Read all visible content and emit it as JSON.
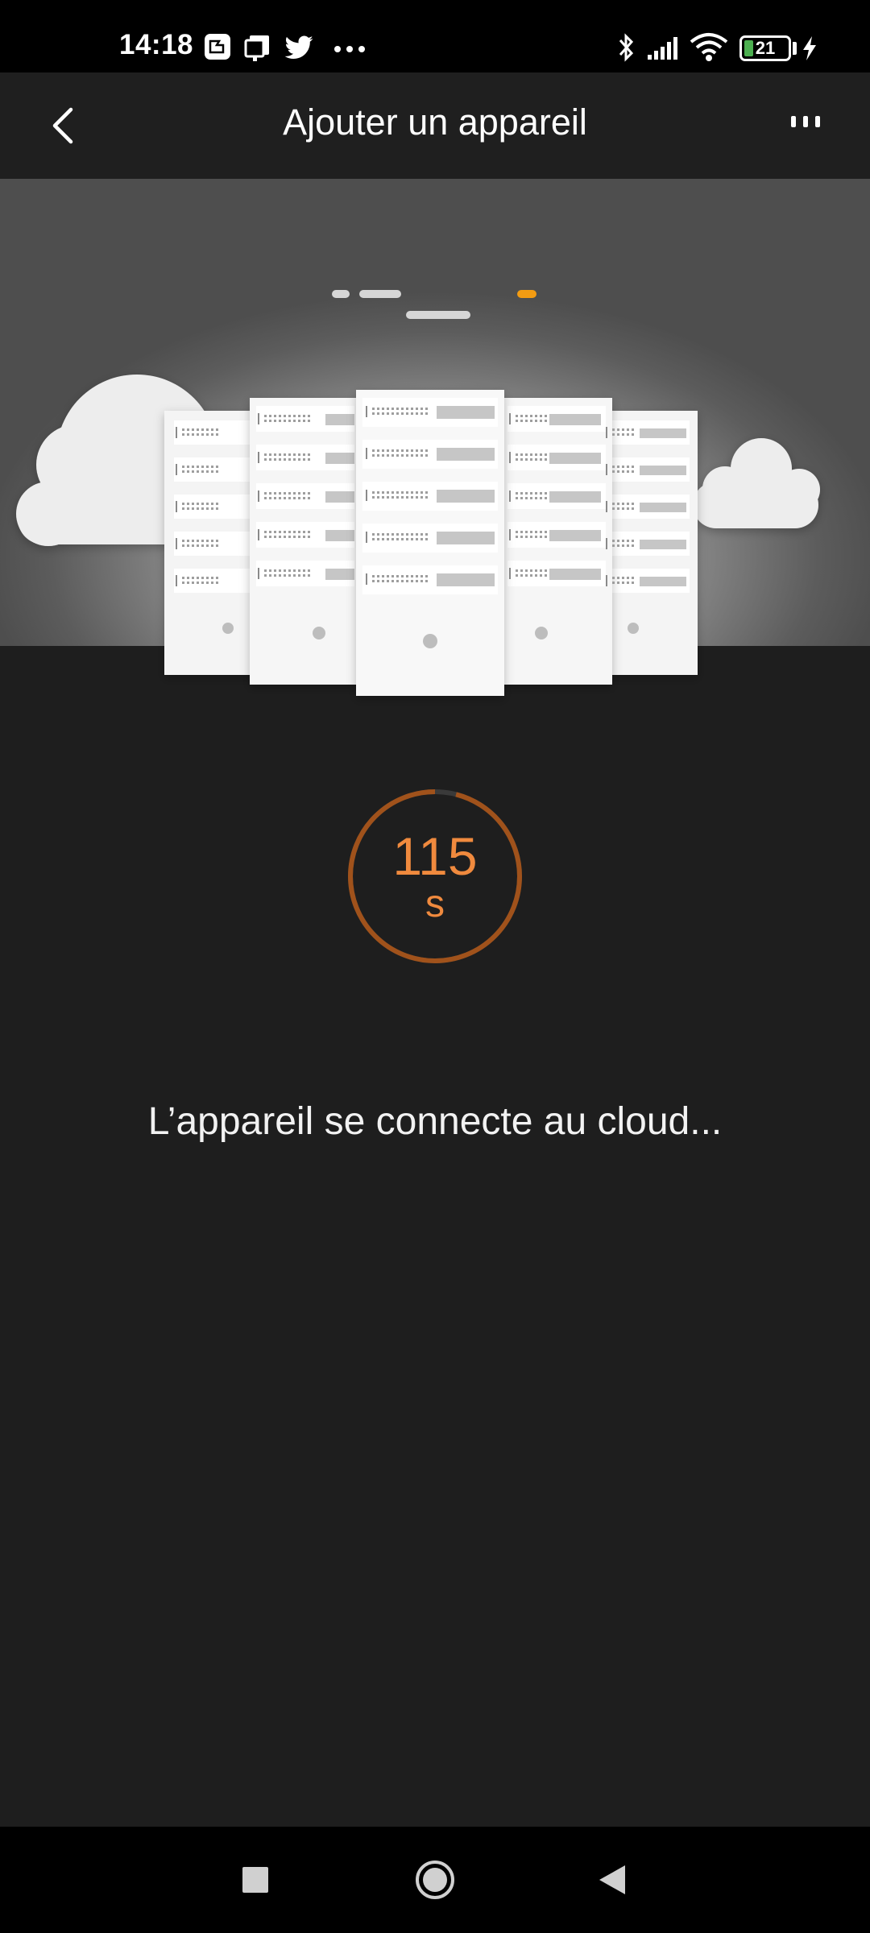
{
  "status_bar": {
    "time": "14:18",
    "battery_level": "21",
    "battery_fraction": 0.21,
    "icons": [
      "gallery-notification-icon",
      "device-notification-icon",
      "twitter-icon",
      "more-notifications-icon",
      "bluetooth-icon",
      "signal-icon",
      "wifi-icon",
      "battery-icon",
      "charging-icon"
    ]
  },
  "app_bar": {
    "title": "Ajouter un appareil",
    "back_icon": "chevron-left-icon",
    "more_icon": "more-vertical-icon"
  },
  "illustration": {
    "subject": "server racks between clouds",
    "accent_color": "#f39c12"
  },
  "countdown": {
    "value": "115",
    "unit": "s",
    "ring_color": "#a0521b",
    "text_color": "#f08a3e",
    "progress_fraction": 0.96
  },
  "message": "L’appareil se connecte au cloud...",
  "nav_bar": {
    "buttons": [
      "recents-button",
      "home-button",
      "back-button"
    ]
  }
}
